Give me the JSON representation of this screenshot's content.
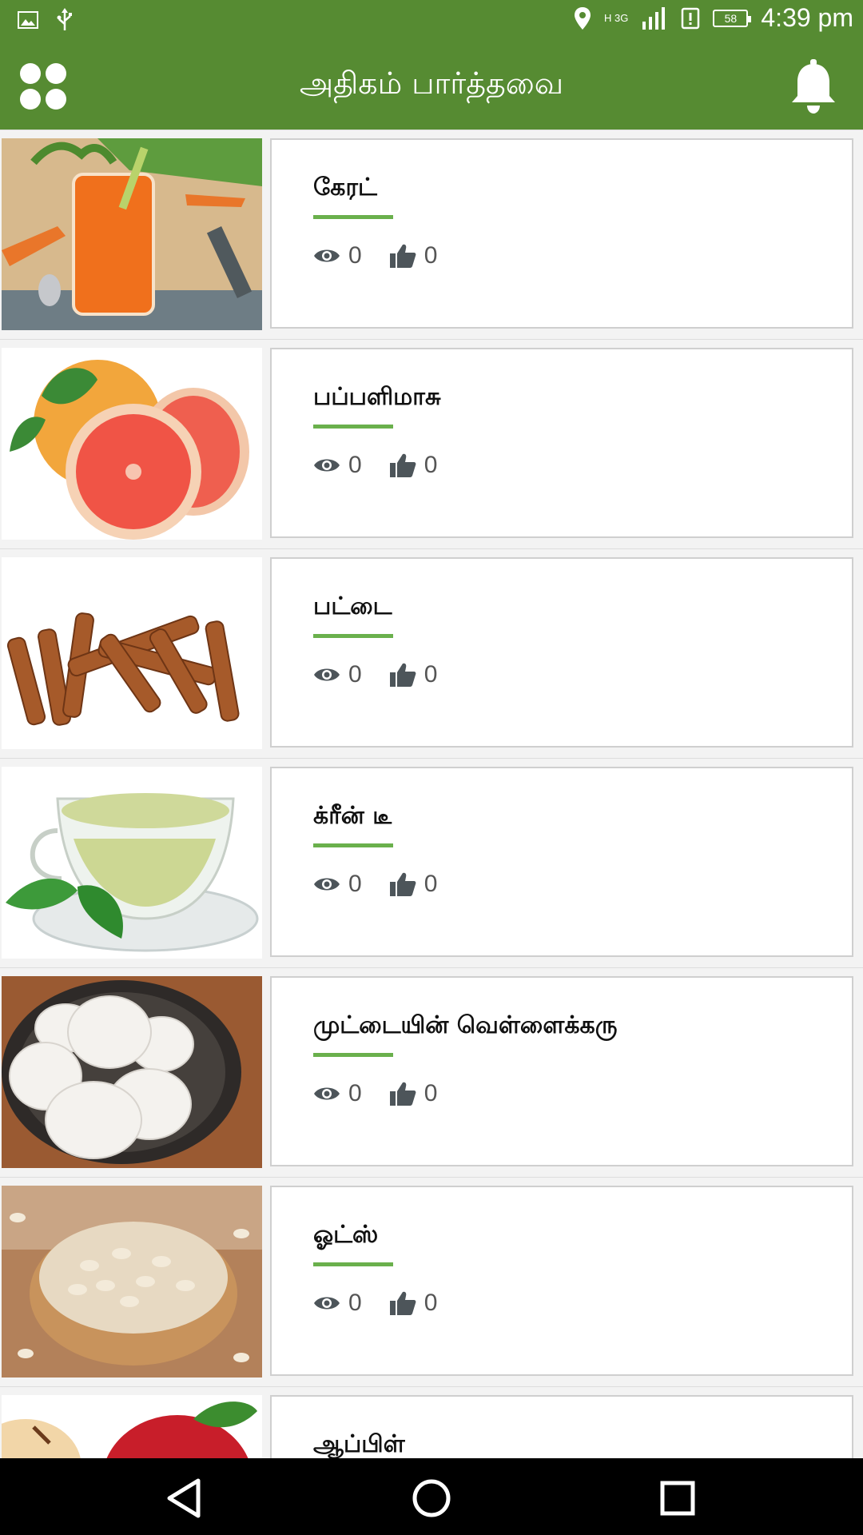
{
  "status_bar": {
    "time": "4:39 pm",
    "battery": "58",
    "network_type": "H 3G",
    "icons": [
      "image-icon",
      "usb-icon",
      "location-icon",
      "signal-icon",
      "alert-icon",
      "battery-icon"
    ]
  },
  "app_bar": {
    "title": "அதிகம் பார்த்தவை",
    "menu_icon": "grid-dots-icon",
    "bell_icon": "bell-icon"
  },
  "colors": {
    "primary": "#568b32",
    "accent_underline": "#6ab04c"
  },
  "items": [
    {
      "name": "கேரட்",
      "views": "0",
      "likes": "0",
      "image": "carrot-juice"
    },
    {
      "name": "பப்பளிமாசு",
      "views": "0",
      "likes": "0",
      "image": "grapefruit"
    },
    {
      "name": "பட்டை",
      "views": "0",
      "likes": "0",
      "image": "cinnamon"
    },
    {
      "name": "க்ரீன் டீ",
      "views": "0",
      "likes": "0",
      "image": "green-tea"
    },
    {
      "name": "முட்டையின் வெள்ளைக்கரு",
      "views": "0",
      "likes": "0",
      "image": "eggs"
    },
    {
      "name": "ஓட்ஸ்",
      "views": "0",
      "likes": "0",
      "image": "oats"
    },
    {
      "name": "ஆப்பிள்",
      "image": "apple"
    }
  ],
  "nav_bar": {
    "icons": [
      "back-icon",
      "home-icon",
      "recents-icon"
    ]
  }
}
